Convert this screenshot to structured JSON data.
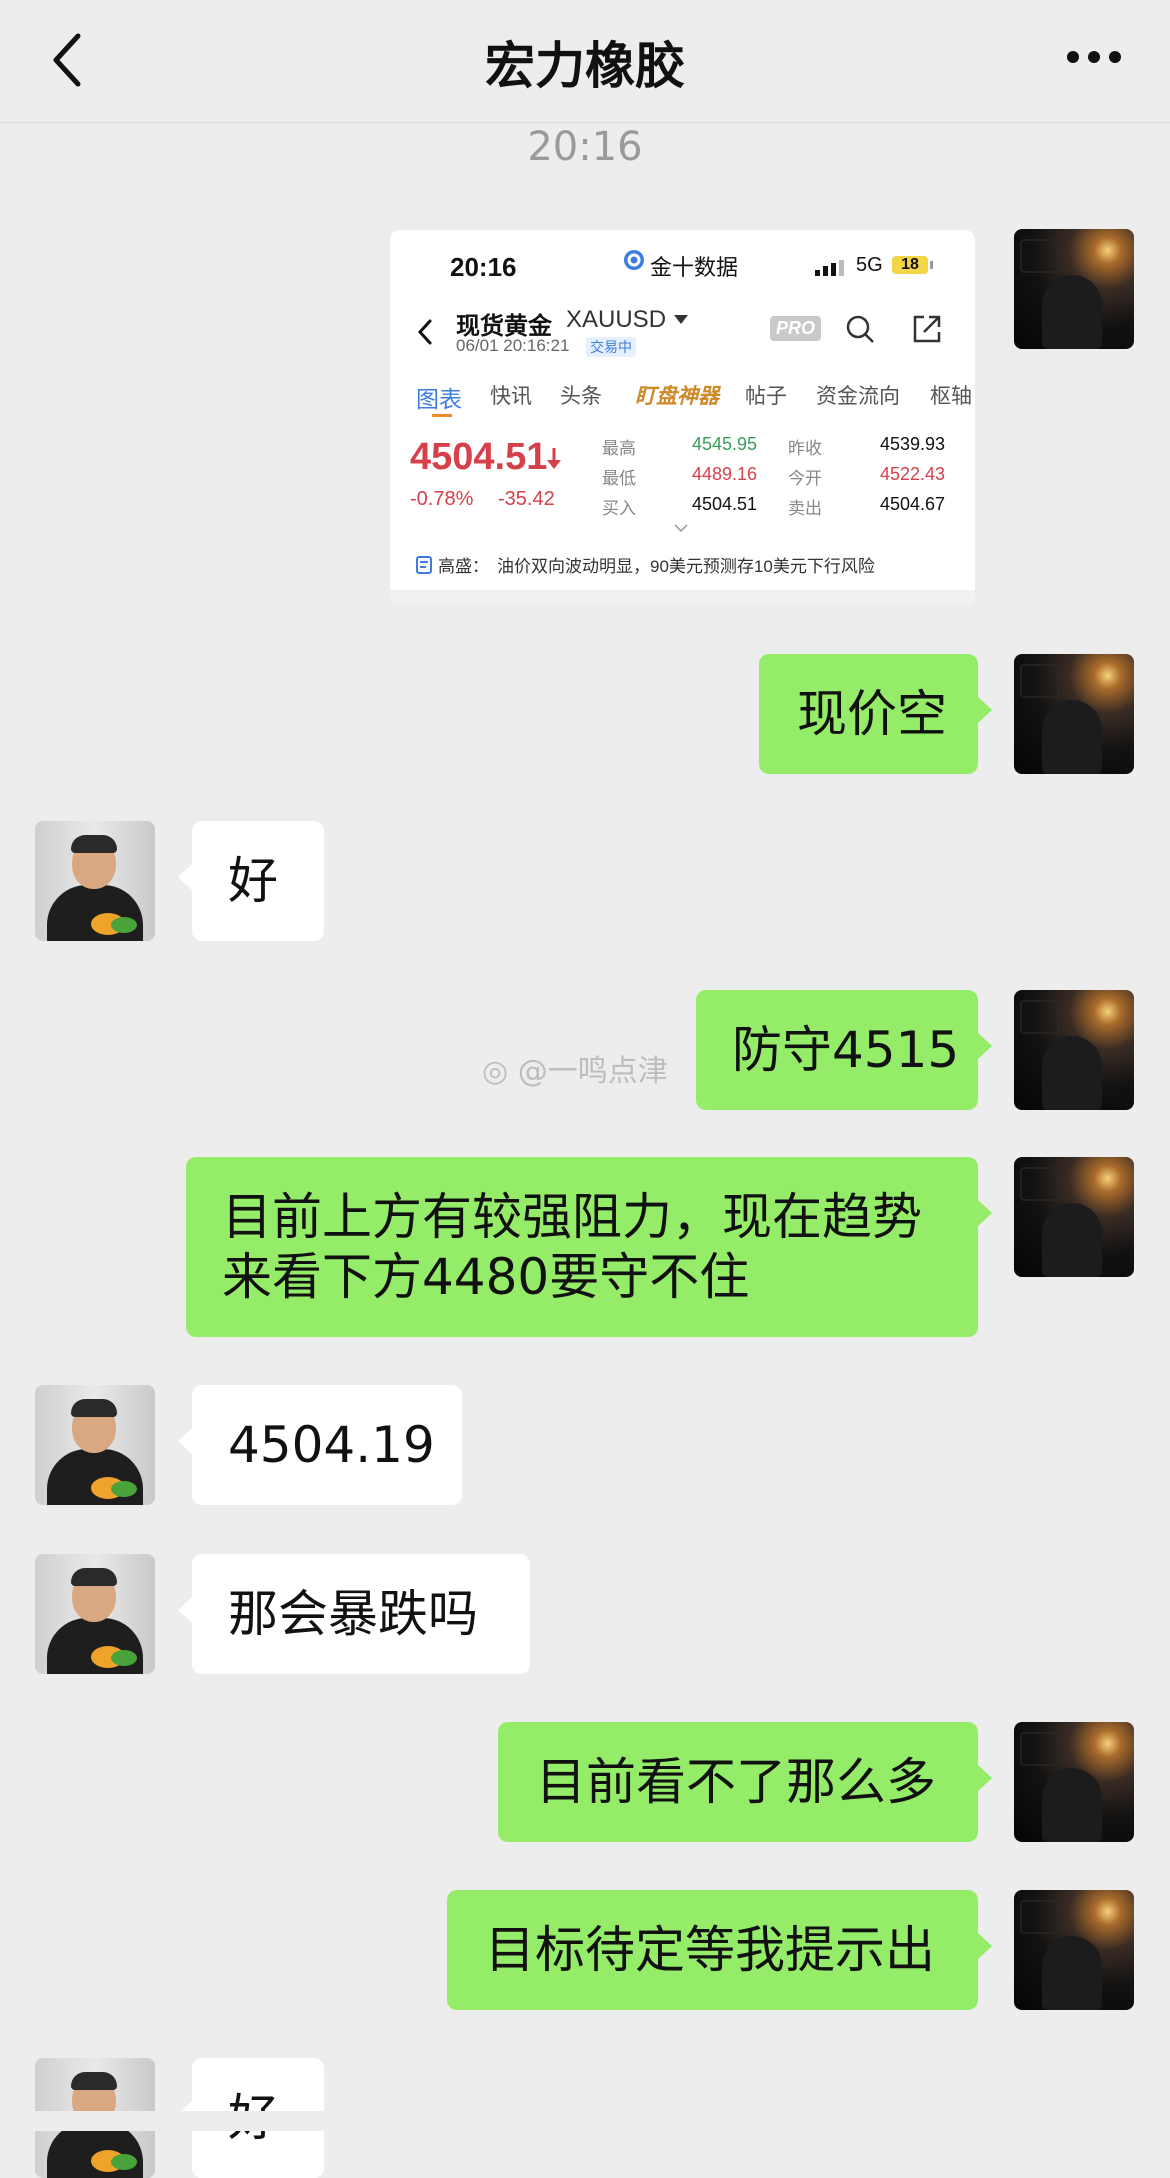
{
  "header": {
    "title": "宏力橡胶",
    "back_icon": "chevron-left-icon",
    "more_icon": "more-dots-icon"
  },
  "timestamp": "20:16",
  "screenshot_card": {
    "status_time": "20:16",
    "app_name": "金十数据",
    "network": "5G",
    "battery": "18",
    "instrument_name": "现货黄金",
    "instrument_code": "XAUUSD",
    "datetime": "06/01 20:16:21",
    "trading_status": "交易中",
    "pro_badge": "PRO",
    "tabs": [
      "图表",
      "快讯",
      "头条",
      "盯盘神器",
      "帖子",
      "资金流向",
      "枢轴"
    ],
    "price": "4504.51",
    "change_pct": "-0.78%",
    "change_abs": "-35.42",
    "stats": [
      {
        "label": "最高",
        "value": "4545.95",
        "label2": "昨收",
        "value2": "4539.93"
      },
      {
        "label": "最低",
        "value": "4489.16",
        "label2": "今开",
        "value2": "4522.43"
      },
      {
        "label": "买入",
        "value": "4504.51",
        "label2": "卖出",
        "value2": "4504.67"
      }
    ],
    "news_source": "高盛",
    "news_text": "油价双向波动明显，90美元预测存10美元下行风险",
    "colors": {
      "up": "#3a9d5d",
      "down": "#d6404a",
      "accent": "#3d7de0"
    }
  },
  "messages": [
    {
      "side": "right",
      "text": "现价空"
    },
    {
      "side": "left",
      "text": "好"
    },
    {
      "side": "right",
      "text": "防守4515"
    },
    {
      "side": "right",
      "lines": [
        "目前上方有较强阻力，现在趋势",
        "来看下方4480要守不住"
      ]
    },
    {
      "side": "left",
      "text": "4504.19"
    },
    {
      "side": "left",
      "text": "那会暴跌吗"
    },
    {
      "side": "right",
      "text": "目前看不了那么多"
    },
    {
      "side": "right",
      "text": "目标待定等我提示出"
    },
    {
      "side": "left",
      "text": "好"
    }
  ],
  "watermark": "@一鸣点津",
  "colors": {
    "green_bubble": "#95ec69",
    "background": "#ededed"
  }
}
